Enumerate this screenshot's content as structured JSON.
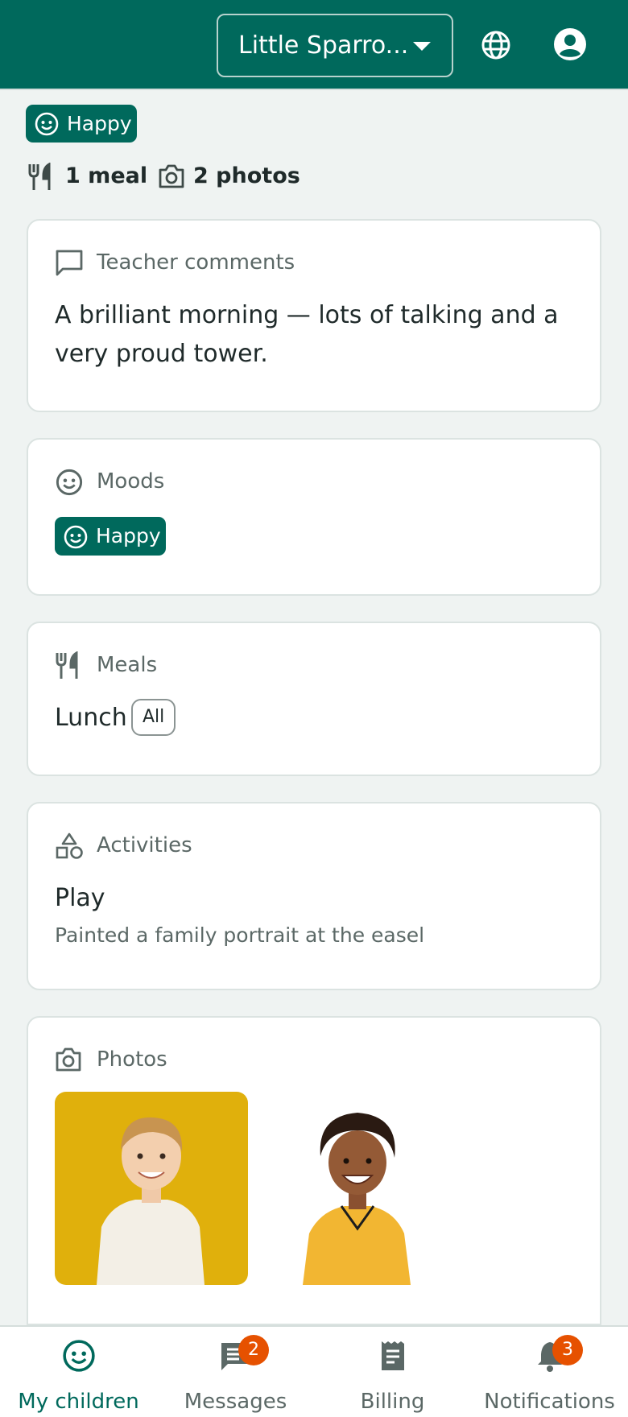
{
  "header": {
    "school_name": "Little Sparro...",
    "icons": [
      "globe-icon",
      "account-circle-icon",
      "chevron-down-icon"
    ]
  },
  "summary": {
    "mood": "Happy",
    "meals": "1 meal",
    "photos": "2 photos"
  },
  "teacher_comments": {
    "heading": "Teacher comments",
    "text": "A brilliant morning — lots of talking and a very proud tower."
  },
  "moods": {
    "heading": "Moods",
    "items": [
      "Happy"
    ]
  },
  "meals": {
    "heading": "Meals",
    "items": [
      {
        "name": "Lunch",
        "amount": "All"
      }
    ]
  },
  "activities": {
    "heading": "Activities",
    "items": [
      {
        "title": "Play",
        "description": "Painted a family portrait at the easel"
      }
    ]
  },
  "photos": {
    "heading": "Photos"
  },
  "bottom_nav": [
    {
      "label": "My children",
      "icon": "child-face-icon",
      "active": true
    },
    {
      "label": "Messages",
      "icon": "chat-icon",
      "badge": "2"
    },
    {
      "label": "Billing",
      "icon": "receipt-icon"
    },
    {
      "label": "Notifications",
      "icon": "bell-icon",
      "badge": "3"
    }
  ],
  "colors": {
    "primary": "#00695c",
    "background": "#eff3f2",
    "badge": "#e65100"
  }
}
